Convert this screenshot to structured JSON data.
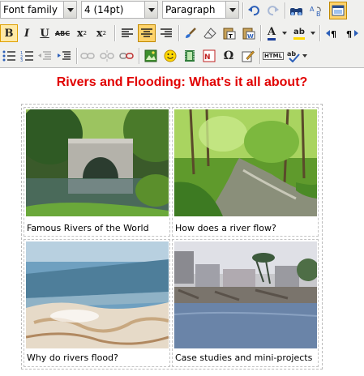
{
  "toolbar": {
    "font_family": "Font family",
    "font_size": "4 (14pt)",
    "block_format": "Paragraph",
    "bold_label": "B",
    "italic_label": "I",
    "underline_label": "U",
    "strike_label": "ABC",
    "subscript_label": "x",
    "subscript_mark": "2",
    "superscript_label": "x",
    "superscript_mark": "2",
    "omega_label": "Ω",
    "html_label": "HTML",
    "spell_label": "ab",
    "forecolor_label": "A"
  },
  "content": {
    "title": "Rivers and Flooding: What's it all about?",
    "tiles": [
      {
        "caption": "Famous Rivers of the World"
      },
      {
        "caption": "How does a river flow?"
      },
      {
        "caption": "Why do rivers flood?"
      },
      {
        "caption": "Case studies and mini-projects"
      }
    ]
  },
  "colors": {
    "title": "#e10000",
    "toolbar_bg": "#f0f0ee",
    "active_button": "#ffd36b"
  }
}
